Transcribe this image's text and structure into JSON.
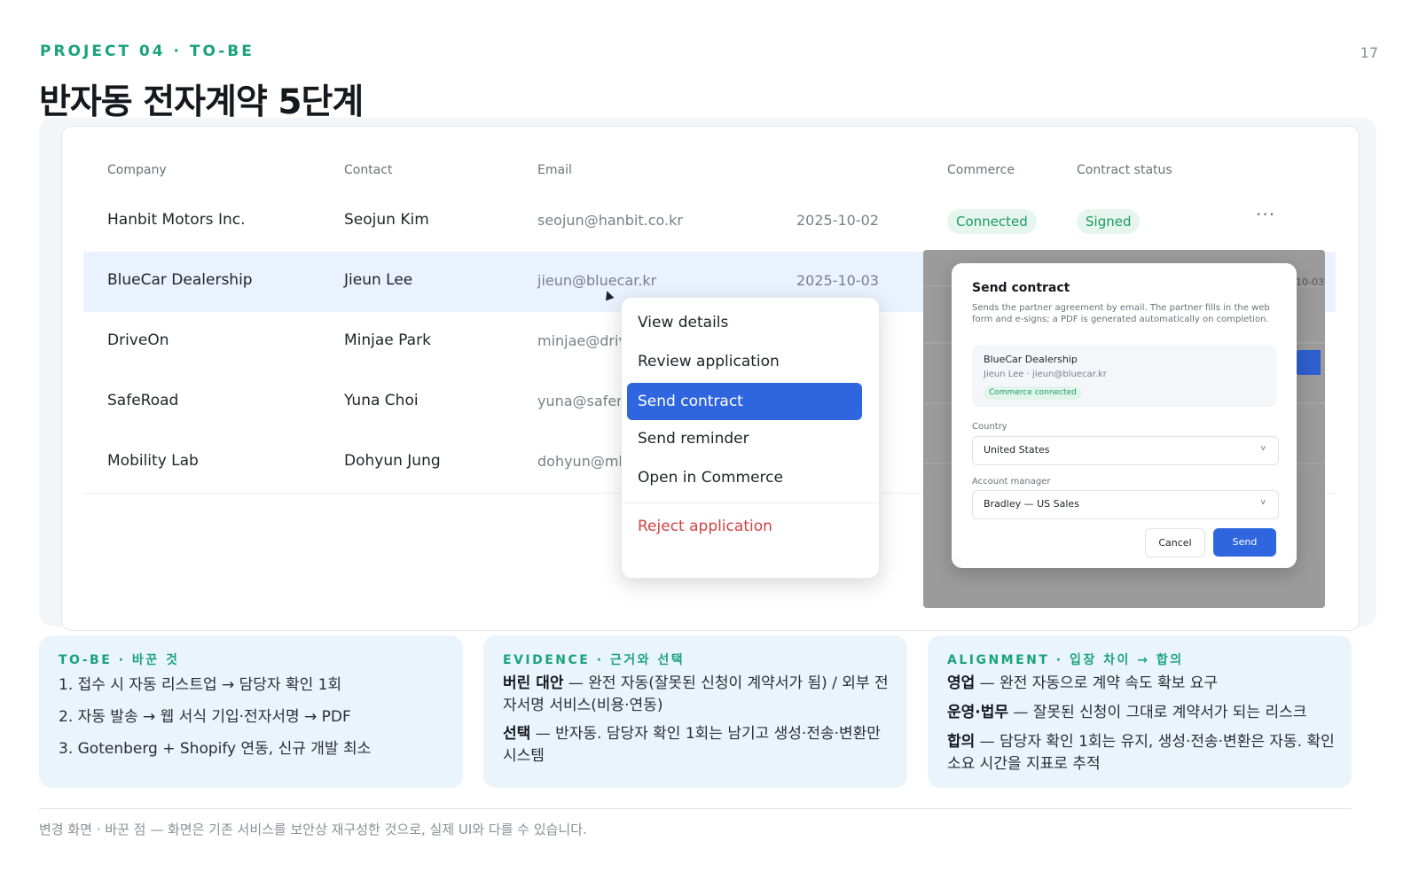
{
  "header": {
    "eyebrow": "PROJECT 04 · TO-BE",
    "page_number": "17",
    "title": "반자동 전자계약 5단계"
  },
  "table": {
    "columns": [
      "Company",
      "Contact",
      "Email",
      "Commerce",
      "Contract status"
    ],
    "rows": [
      {
        "company": "Hanbit Motors Inc.",
        "contact": "Seojun Kim",
        "email": "seojun@hanbit.co.kr",
        "date": "2025-10-02",
        "commerce": "Connected",
        "status": "Signed",
        "more": "···"
      },
      {
        "company": "BlueCar Dealership",
        "contact": "Jieun Lee",
        "email": "jieun@bluecar.kr",
        "date": "2025-10-03"
      },
      {
        "company": "DriveOn",
        "contact": "Minjae Park",
        "email": "minjae@driv"
      },
      {
        "company": "SafeRoad",
        "contact": "Yuna Choi",
        "email": "yuna@saferc"
      },
      {
        "company": "Mobility Lab",
        "contact": "Dohyun Jung",
        "email": "dohyun@mla"
      }
    ]
  },
  "context_menu": {
    "items": [
      "View details",
      "Review application",
      "Send contract",
      "Send reminder",
      "Open in Commerce"
    ],
    "danger_item": "Reject application"
  },
  "modal": {
    "background_date": "10-03",
    "title": "Send contract",
    "description": "Sends the partner agreement by email. The partner fills in the web form and e-signs; a PDF is generated automatically on completion.",
    "partner_name": "BlueCar Dealership",
    "partner_contact": "Jieun Lee · jieun@bluecar.kr",
    "partner_badge": "Commerce connected",
    "country_label": "Country",
    "country_value": "United States",
    "manager_label": "Account manager",
    "manager_value": "Bradley — US Sales",
    "chevron": "v",
    "cancel_label": "Cancel",
    "send_label": "Send"
  },
  "cards": [
    {
      "heading": "TO-BE · 바꾼 것",
      "lines": [
        "1. 접수 시 자동 리스트업 → 담당자 확인 1회",
        "2. 자동 발송 → 웹 서식 기입·전자서명 → PDF",
        "3. Gotenberg + Shopify 연동, 신규 개발 최소"
      ]
    },
    {
      "heading": "EVIDENCE · 근거와 선택",
      "items": [
        {
          "term": "버린 대안",
          "text": " — 완전 자동(잘못된 신청이 계약서가 됨) / 외부 전자서명 서비스(비용·연동)"
        },
        {
          "term": "선택",
          "text": " — 반자동. 담당자 확인 1회는 남기고 생성·전송·변환만 시스템"
        }
      ]
    },
    {
      "heading": "ALIGNMENT · 입장 차이 → 합의",
      "items": [
        {
          "term": "영업",
          "text": " — 완전 자동으로 계약 속도 확보 요구"
        },
        {
          "term": "운영·법무",
          "text": " — 잘못된 신청이 그대로 계약서가 되는 리스크"
        },
        {
          "term": "합의",
          "text": " — 담당자 확인 1회는 유지, 생성·전송·변환은 자동. 확인 소요 시간을 지표로 추적"
        }
      ]
    }
  ],
  "footer": "변경 화면 · 바꾼 점 — 화면은 기존 서비스를 보안상 재구성한 것으로, 실제 UI와 다를 수 있습니다.",
  "colors": {
    "accent_green": "#1aa37a",
    "primary_blue": "#2f66e0",
    "danger_red": "#d14343",
    "card_bg": "#eaf4fd"
  }
}
